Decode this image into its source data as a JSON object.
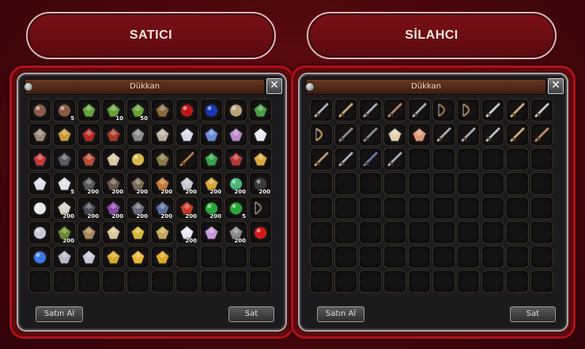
{
  "headers": {
    "left": "SATICI",
    "right": "SİLAHCI"
  },
  "left_window": {
    "title": "Dükkan",
    "close_label": "✕",
    "buy_label": "Satın Al",
    "sell_label": "Sat",
    "items": [
      {
        "icon": "helmet-icon",
        "color": "#8c5a4a"
      },
      {
        "icon": "helmet-icon",
        "color": "#8c5a4a",
        "count": "5"
      },
      {
        "icon": "feather-icon",
        "color": "#6aa03a"
      },
      {
        "icon": "feather-icon",
        "color": "#6aa03a",
        "count": "10"
      },
      {
        "icon": "feather-icon",
        "color": "#6aa03a",
        "count": "50"
      },
      {
        "icon": "wood-plank-icon",
        "color": "#8a6a3a"
      },
      {
        "icon": "red-potion-icon",
        "color": "#c01818"
      },
      {
        "icon": "blue-potion-icon",
        "color": "#1838b8"
      },
      {
        "icon": "compass-icon",
        "color": "#b8a478"
      },
      {
        "icon": "scroll-icon",
        "color": "#48a048"
      },
      {
        "icon": "claw-icon",
        "color": "#9a8a7a"
      },
      {
        "icon": "gold-leaf-icon",
        "color": "#c89a38"
      },
      {
        "icon": "red-gem-icon",
        "color": "#b82828"
      },
      {
        "icon": "red-ore-icon",
        "color": "#a83a2a"
      },
      {
        "icon": "stone-icon",
        "color": "#8a8a8a"
      },
      {
        "icon": "shard-icon",
        "color": "#c0b0a0"
      },
      {
        "icon": "crystal-icon",
        "color": "#d8d8e8"
      },
      {
        "icon": "blue-crystal-icon",
        "color": "#6a8ad8"
      },
      {
        "icon": "pink-crystal-icon",
        "color": "#b888c8"
      },
      {
        "icon": "white-crystal-icon",
        "color": "#e8e8f0"
      },
      {
        "icon": "red-crystal-icon",
        "color": "#c83838"
      },
      {
        "icon": "dark-crystal-icon",
        "color": "#5a5a6a"
      },
      {
        "icon": "red-stone-icon",
        "color": "#b84a3a"
      },
      {
        "icon": "map-icon",
        "color": "#d8c8a8"
      },
      {
        "icon": "ring-icon",
        "color": "#d8b848"
      },
      {
        "icon": "book-icon",
        "color": "#8a7a4a"
      },
      {
        "icon": "stick-icon",
        "color": "#b07a3a"
      },
      {
        "icon": "clover-icon",
        "color": "#38a048"
      },
      {
        "icon": "chest-icon",
        "color": "#b83838"
      },
      {
        "icon": "key-icon",
        "color": "#d8a838"
      },
      {
        "icon": "diamond-icon",
        "color": "#e0e0e8"
      },
      {
        "icon": "diamond-icon",
        "color": "#e0e0e8",
        "count": "5"
      },
      {
        "icon": "ore-icon",
        "color": "#5a5a5a",
        "count": "200"
      },
      {
        "icon": "ore-icon",
        "color": "#6a5a4a",
        "count": "200"
      },
      {
        "icon": "ore-icon",
        "color": "#7a6a5a",
        "count": "200"
      },
      {
        "icon": "copper-bar-icon",
        "color": "#c87838",
        "count": "200"
      },
      {
        "icon": "silver-bar-icon",
        "color": "#c8c8d0",
        "count": "200"
      },
      {
        "icon": "gold-bar-icon",
        "color": "#d8a838",
        "count": "200"
      },
      {
        "icon": "jade-icon",
        "color": "#48b878",
        "count": "200"
      },
      {
        "icon": "black-pearl-icon",
        "color": "#3a3a3a",
        "count": "200"
      },
      {
        "icon": "white-pearl-icon",
        "color": "#e8e8e8"
      },
      {
        "icon": "cloth-icon",
        "color": "#d8d0c0",
        "count": "200"
      },
      {
        "icon": "dark-ore-icon",
        "color": "#4a4a5a",
        "count": "200"
      },
      {
        "icon": "purple-ore-icon",
        "color": "#8a48a8",
        "count": "200"
      },
      {
        "icon": "iron-bar-icon",
        "color": "#6a6a7a",
        "count": "200"
      },
      {
        "icon": "sapphire-icon",
        "color": "#5a6a9a",
        "count": "200"
      },
      {
        "icon": "ruby-bar-icon",
        "color": "#c83828",
        "count": "200"
      },
      {
        "icon": "green-orb-icon",
        "color": "#28a838",
        "count": "200"
      },
      {
        "icon": "green-orb-icon",
        "color": "#28a838",
        "count": "5"
      },
      {
        "icon": "horseshoe-icon",
        "color": "#7a6a5a"
      },
      {
        "icon": "ring-stone-icon",
        "color": "#c8c8d8"
      },
      {
        "icon": "herb-bundle-icon",
        "color": "#6a8a2a",
        "count": "200"
      },
      {
        "icon": "tablet-icon",
        "color": "#a8885a"
      },
      {
        "icon": "parchment-icon",
        "color": "#d8c898"
      },
      {
        "icon": "gold-rope-icon",
        "color": "#d8b838"
      },
      {
        "icon": "cape-icon",
        "color": "#c8a858"
      },
      {
        "icon": "star-icon",
        "color": "#e8e8f8",
        "count": "200"
      },
      {
        "icon": "wing-icon",
        "color": "#c898d8"
      },
      {
        "icon": "stone-stack-icon",
        "color": "#8a8a8a",
        "count": "200"
      },
      {
        "icon": "red-sack-icon",
        "color": "#d81818"
      },
      {
        "icon": "blue-aura-icon",
        "color": "#3a78e8"
      },
      {
        "icon": "silver-ingot-icon",
        "color": "#b8b8c8"
      },
      {
        "icon": "silver-ingot-icon",
        "color": "#c8c8d8"
      },
      {
        "icon": "gold-ingot-icon",
        "color": "#d8a828"
      },
      {
        "icon": "gold-ingot-icon",
        "color": "#e8b838"
      },
      {
        "icon": "gold-ingot-icon",
        "color": "#d8a828"
      }
    ]
  },
  "right_window": {
    "title": "Dükkan",
    "close_label": "✕",
    "buy_label": "Satın Al",
    "sell_label": "Sat",
    "items": [
      {
        "icon": "scimitar-icon",
        "color": "#b0b0b8"
      },
      {
        "icon": "broadsword-icon",
        "color": "#c0a878"
      },
      {
        "icon": "dagger-icon",
        "color": "#a8a8b0"
      },
      {
        "icon": "dagger-icon",
        "color": "#b08868"
      },
      {
        "icon": "spear-icon",
        "color": "#a8a8b0"
      },
      {
        "icon": "bow-icon",
        "color": "#8a6a3a"
      },
      {
        "icon": "bow-icon",
        "color": "#9a7a4a"
      },
      {
        "icon": "blade-icon",
        "color": "#c8c8d0"
      },
      {
        "icon": "greatsword-icon",
        "color": "#c8a878"
      },
      {
        "icon": "dagger-icon",
        "color": "#c8c8c8"
      },
      {
        "icon": "bow-icon",
        "color": "#b08858"
      },
      {
        "icon": "spear-icon",
        "color": "#888890"
      },
      {
        "icon": "spear-icon",
        "color": "#888890"
      },
      {
        "icon": "fan-icon",
        "color": "#e0d0b0"
      },
      {
        "icon": "fan-icon",
        "color": "#e09878"
      },
      {
        "icon": "spear-icon",
        "color": "#a8a8a8"
      },
      {
        "icon": "spear-icon",
        "color": "#a8a8a8"
      },
      {
        "icon": "blade-icon",
        "color": "#b8b8c0"
      },
      {
        "icon": "greatsword-icon",
        "color": "#c8a878"
      },
      {
        "icon": "arrow-icon",
        "color": "#b88868"
      },
      {
        "icon": "arrow-icon",
        "color": "#b89878"
      },
      {
        "icon": "arrow-icon",
        "color": "#a8a8b8"
      },
      {
        "icon": "arrow-icon",
        "color": "#6878a8"
      },
      {
        "icon": "arrow-icon",
        "color": "#a8a8b8"
      }
    ]
  }
}
